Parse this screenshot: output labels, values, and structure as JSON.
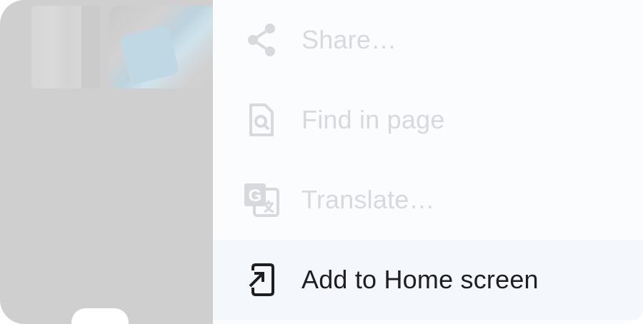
{
  "menu": {
    "items": [
      {
        "label": "Share…",
        "icon": "share-icon",
        "enabled": false
      },
      {
        "label": "Find in page",
        "icon": "find-in-page-icon",
        "enabled": false
      },
      {
        "label": "Translate…",
        "icon": "translate-icon",
        "enabled": false
      },
      {
        "label": "Add to Home screen",
        "icon": "add-to-home-screen-icon",
        "enabled": true
      }
    ]
  },
  "colors": {
    "disabled_text": "#d7d9dd",
    "enabled_text": "#1f1f22",
    "highlight_background": "#f4f7fc",
    "scrim": "#cfcfcf"
  }
}
